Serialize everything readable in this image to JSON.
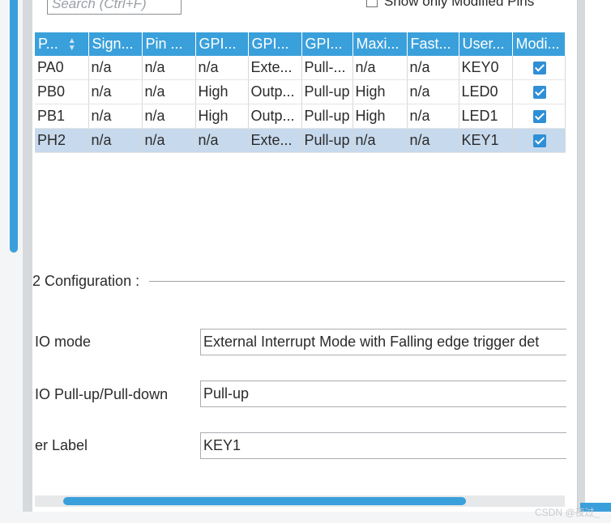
{
  "toolbar": {
    "search_placeholder": "Search (Ctrl+F)",
    "show_modified_label": "Show only Modified Pins"
  },
  "pin_table": {
    "headers": [
      "P...",
      "Sign...",
      "Pin ...",
      "GPI...",
      "GPI...",
      "GPI...",
      "Maxi...",
      "Fast...",
      "User...",
      "Modi..."
    ],
    "rows": [
      {
        "pin": "PA0",
        "signal": "n/a",
        "pin_ctx": "n/a",
        "gpio_out": "n/a",
        "gpio_mode": "Exte...",
        "gpio_pull": "Pull-...",
        "max_speed": "n/a",
        "fast_mode": "n/a",
        "user_label": "KEY0",
        "modified": true
      },
      {
        "pin": "PB0",
        "signal": "n/a",
        "pin_ctx": "n/a",
        "gpio_out": "High",
        "gpio_mode": "Outp...",
        "gpio_pull": "Pull-up",
        "max_speed": "High",
        "fast_mode": "n/a",
        "user_label": "LED0",
        "modified": true
      },
      {
        "pin": "PB1",
        "signal": "n/a",
        "pin_ctx": "n/a",
        "gpio_out": "High",
        "gpio_mode": "Outp...",
        "gpio_pull": "Pull-up",
        "max_speed": "High",
        "fast_mode": "n/a",
        "user_label": "LED1",
        "modified": true
      },
      {
        "pin": "PH2",
        "signal": "n/a",
        "pin_ctx": "n/a",
        "gpio_out": "n/a",
        "gpio_mode": "Exte...",
        "gpio_pull": "Pull-up",
        "max_speed": "n/a",
        "fast_mode": "n/a",
        "user_label": "KEY1",
        "modified": true
      }
    ],
    "selected_row": 3
  },
  "config": {
    "section_title": "2 Configuration :",
    "gpio_mode_label": "IO mode",
    "gpio_mode_value": "External Interrupt Mode with Falling edge trigger det",
    "pull_label": "IO Pull-up/Pull-down",
    "pull_value": "Pull-up",
    "user_label_label": "er Label",
    "user_label_value": "KEY1"
  },
  "footer": {
    "watermark": "CSDN @夜过_"
  },
  "colors": {
    "accent": "#3aa0db",
    "selected_row": "#c7d9ec",
    "checkbox": "#2f8fd6"
  }
}
